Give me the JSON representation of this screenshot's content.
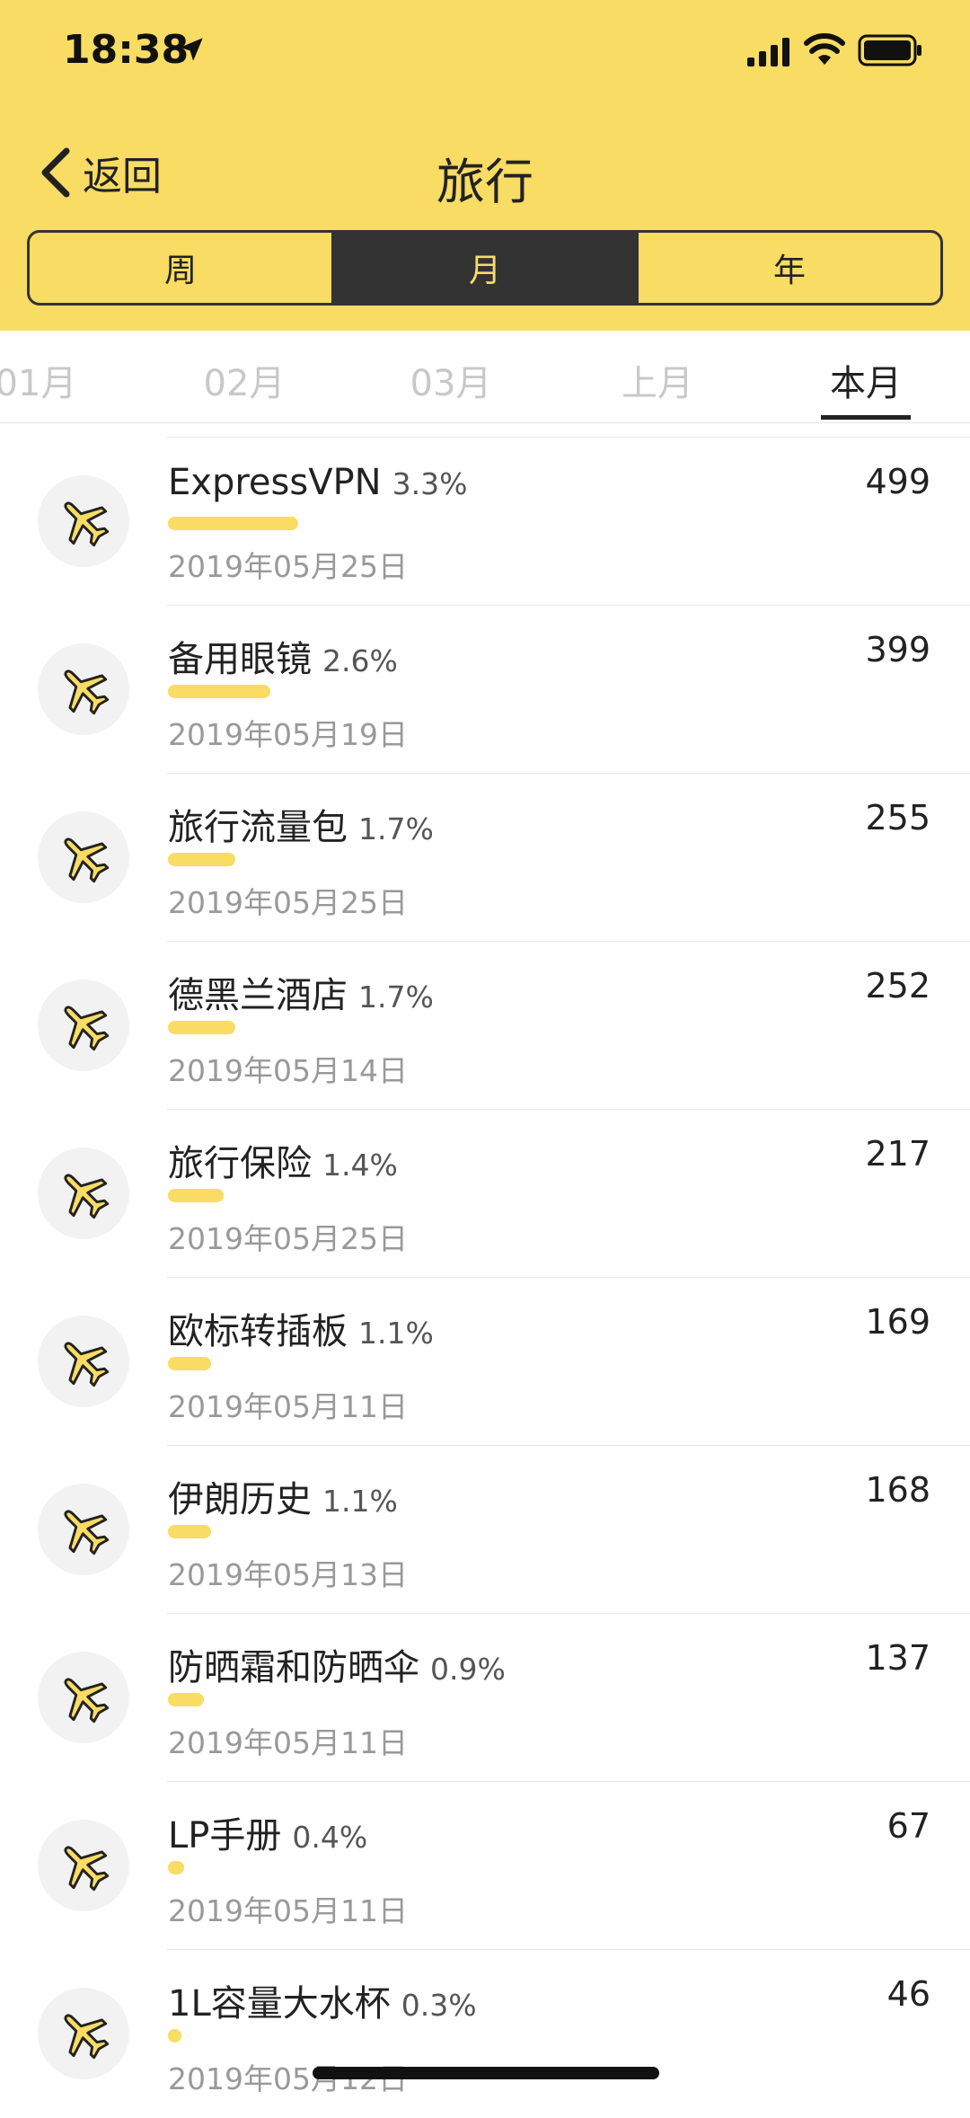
{
  "status_bar": {
    "time": "18:38"
  },
  "nav": {
    "back_label": "返回",
    "title": "旅行"
  },
  "period_segments": [
    {
      "label": "周",
      "active": false
    },
    {
      "label": "月",
      "active": true
    },
    {
      "label": "年",
      "active": false
    }
  ],
  "month_tabs": [
    {
      "label": "01月",
      "active": false
    },
    {
      "label": "02月",
      "active": false
    },
    {
      "label": "03月",
      "active": false
    },
    {
      "label": "上月",
      "active": false
    },
    {
      "label": "本月",
      "active": true
    }
  ],
  "items": [
    {
      "name": "ExpressVPN",
      "percent": "3.3%",
      "share": 0.033,
      "date": "2019年05月25日",
      "amount": "499"
    },
    {
      "name": "备用眼镜",
      "percent": "2.6%",
      "share": 0.026,
      "date": "2019年05月19日",
      "amount": "399"
    },
    {
      "name": "旅行流量包",
      "percent": "1.7%",
      "share": 0.017,
      "date": "2019年05月25日",
      "amount": "255"
    },
    {
      "name": "德黑兰酒店",
      "percent": "1.7%",
      "share": 0.017,
      "date": "2019年05月14日",
      "amount": "252"
    },
    {
      "name": "旅行保险",
      "percent": "1.4%",
      "share": 0.014,
      "date": "2019年05月25日",
      "amount": "217"
    },
    {
      "name": "欧标转插板",
      "percent": "1.1%",
      "share": 0.011,
      "date": "2019年05月11日",
      "amount": "169"
    },
    {
      "name": "伊朗历史",
      "percent": "1.1%",
      "share": 0.011,
      "date": "2019年05月13日",
      "amount": "168"
    },
    {
      "name": "防晒霜和防晒伞",
      "percent": "0.9%",
      "share": 0.009,
      "date": "2019年05月11日",
      "amount": "137"
    },
    {
      "name": "LP手册",
      "percent": "0.4%",
      "share": 0.004,
      "date": "2019年05月11日",
      "amount": "67"
    },
    {
      "name": "1L容量大水杯",
      "percent": "0.3%",
      "share": 0.003,
      "date": "2019年05月12日",
      "amount": "46"
    }
  ],
  "colors": {
    "accent": "#f8dc63",
    "dark": "#333333"
  },
  "icons": {
    "item_icon": "airplane-icon"
  }
}
